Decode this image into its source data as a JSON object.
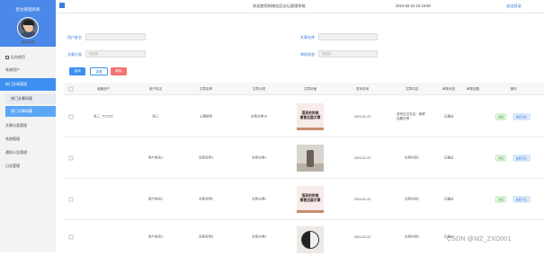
{
  "sidebar": {
    "title": "后台管理系统",
    "user": "超级管理",
    "items": [
      {
        "label": "后台首页"
      },
      {
        "label": "系统用户"
      },
      {
        "label": "热门文章管理"
      },
      {
        "label": "热门文章列表"
      },
      {
        "label": "热门文章收藏"
      },
      {
        "label": "文章分类管理"
      },
      {
        "label": "系统管理"
      },
      {
        "label": "通知公告管理"
      },
      {
        "label": "日志管理"
      }
    ]
  },
  "header": {
    "title": "欢迎使用网络社区论坛管理系统",
    "datetime": "2024-02-23 10:16:50",
    "logout": "退出登录"
  },
  "search": {
    "field1_label": "用户姓名",
    "field2_label": "文章名称",
    "field3_label": "文章分类",
    "field3_placeholder": "请选择",
    "field4_label": "审核状态",
    "field4_placeholder": "请选择",
    "btn_search": "查询",
    "btn_add": "重置",
    "btn_delete": "删除"
  },
  "table": {
    "headers": [
      "",
      "收藏用户",
      "用户姓名",
      "文章名称",
      "文章分类",
      "文章封面",
      "发布时间",
      "文章内容",
      "审核状态",
      "审核回复",
      "操作"
    ],
    "rows": [
      {
        "col1": "张三_TC2231",
        "col2": "张三",
        "col3": "心理疏导",
        "col4": "文章分类10",
        "cover": "card",
        "cover_text": "落英的时候\n看看这篇文章",
        "date": "2024-02-23",
        "content": "游戏社交社区 · 新鲜话题分享",
        "status": "已通过",
        "reply": "",
        "detail": "详情",
        "view": "查看评论"
      },
      {
        "col1": "",
        "col2": "用户姓名1",
        "col3": "文章名称1",
        "col4": "文章分类1",
        "cover": "photo",
        "cover_text": "",
        "date": "2024-02-23",
        "content": "文章内容1",
        "status": "已通过",
        "reply": "",
        "detail": "详情",
        "view": "查看评论"
      },
      {
        "col1": "",
        "col2": "用户姓名2",
        "col3": "文章名称2",
        "col4": "文章分类2",
        "cover": "card",
        "cover_text": "落英的时候\n看看这篇文章",
        "date": "2024-02-23",
        "content": "文章内容2",
        "status": "已通过",
        "reply": "",
        "detail": "详情",
        "view": "查看评论"
      },
      {
        "col1": "",
        "col2": "用户姓名3",
        "col3": "文章名称3",
        "col4": "文章分类3",
        "cover": "yy",
        "cover_text": "",
        "date": "2024-02-23",
        "content": "文章内容3",
        "status": "已通过",
        "reply": "",
        "detail": "详情",
        "view": "查看评论"
      }
    ]
  },
  "watermark": "CSDN @MZ_ZXD001",
  "colors": {
    "accent": "#3d8ff0",
    "danger": "#f47373",
    "success": "#3aa33a"
  }
}
